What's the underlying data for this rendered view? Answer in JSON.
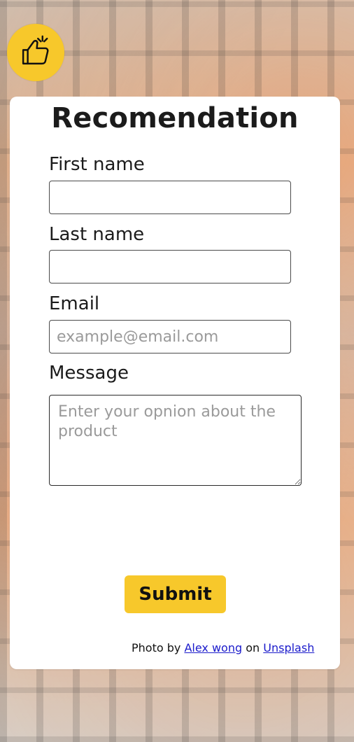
{
  "logo": {
    "icon": "thumbs-up-icon",
    "color": "#f7c82b"
  },
  "form": {
    "title": "Recomendation",
    "first_name": {
      "label": "First name",
      "value": "",
      "placeholder": ""
    },
    "last_name": {
      "label": "Last name",
      "value": "",
      "placeholder": ""
    },
    "email": {
      "label": "Email",
      "value": "",
      "placeholder": "example@email.com"
    },
    "message": {
      "label": "Message",
      "value": "",
      "placeholder": "Enter your opnion about the product"
    },
    "submit_label": "Submit"
  },
  "credit": {
    "prefix": "Photo by",
    "author": "Alex wong",
    "middle": "on",
    "site": "Unsplash"
  }
}
